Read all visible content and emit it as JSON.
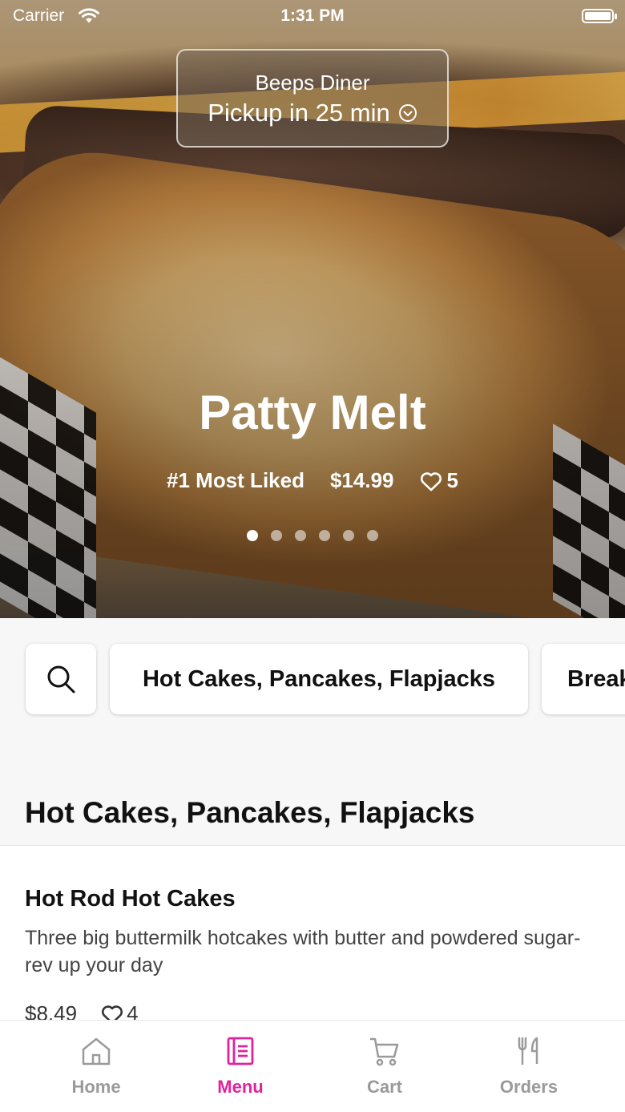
{
  "status_bar": {
    "carrier": "Carrier",
    "time": "1:31 PM"
  },
  "pickup": {
    "restaurant": "Beeps Diner",
    "eta": "Pickup in 25 min"
  },
  "hero": {
    "title": "Patty Melt",
    "rank": "#1 Most Liked",
    "price": "$14.99",
    "likes": "5",
    "carousel_count": 6,
    "carousel_active": 1
  },
  "categories": {
    "chips": [
      "Hot Cakes, Pancakes, Flapjacks",
      "Breakfast"
    ]
  },
  "section": {
    "title": "Hot Cakes, Pancakes, Flapjacks"
  },
  "menu_items": [
    {
      "name": "Hot Rod Hot Cakes",
      "description": "Three big buttermilk hotcakes with butter and powdered sugar-rev up your day",
      "price": "$8.49",
      "likes": "4"
    }
  ],
  "tabbar": {
    "tabs": [
      {
        "label": "Home",
        "icon": "home-icon"
      },
      {
        "label": "Menu",
        "icon": "menu-icon"
      },
      {
        "label": "Cart",
        "icon": "cart-icon"
      },
      {
        "label": "Orders",
        "icon": "orders-icon"
      }
    ],
    "active": "Menu",
    "accent_color": "#e0239b",
    "inactive_color": "#9a9a9a"
  }
}
